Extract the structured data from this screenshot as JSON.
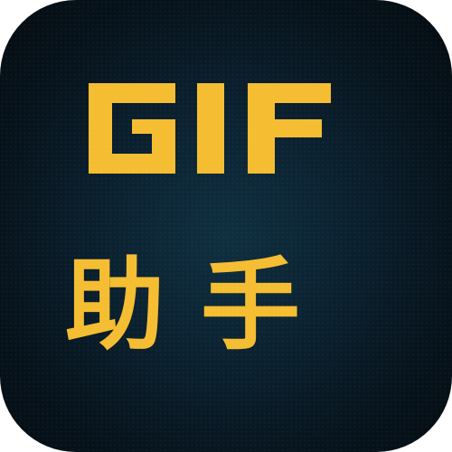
{
  "app_icon": {
    "label_line_1": "GIF",
    "label_line_2": "助手",
    "colors": {
      "text": "#f5bd31",
      "background_center": "#0f3040",
      "background_edge": "#040b10"
    }
  }
}
